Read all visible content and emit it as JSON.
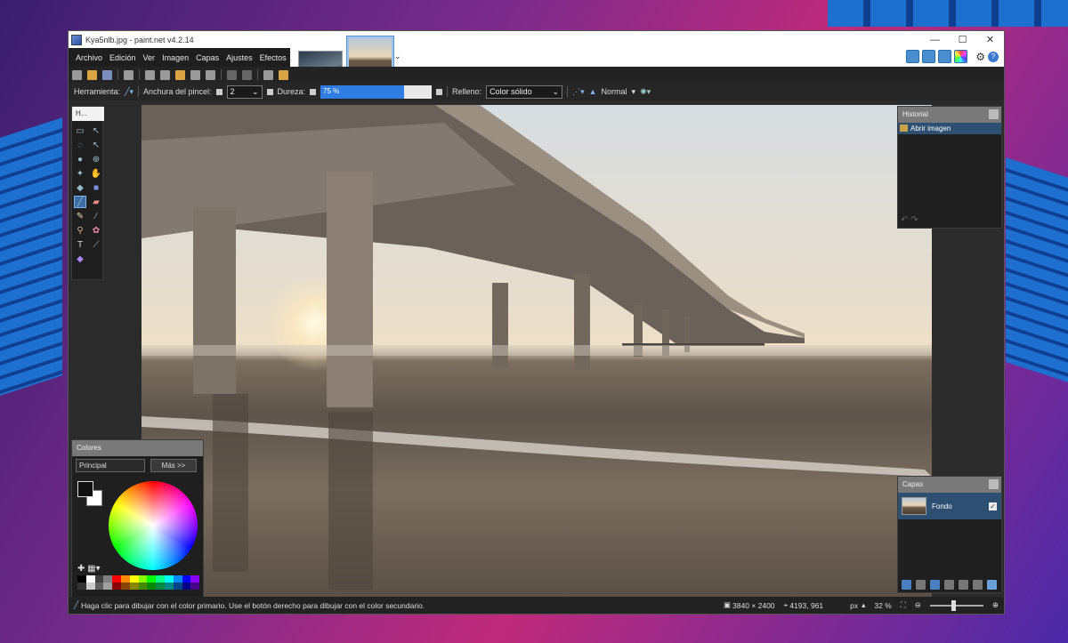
{
  "window": {
    "title": "Kya5nlb.jpg - paint.net v4.2.14"
  },
  "window_controls": {
    "minimize": "—",
    "maximize": "☐",
    "close": "✕"
  },
  "menu": {
    "items": [
      "Archivo",
      "Edición",
      "Ver",
      "Imagen",
      "Capas",
      "Ajustes",
      "Efectos"
    ]
  },
  "options": {
    "tool_label": "Herramienta:",
    "brush_width_label": "Anchura del pincel:",
    "brush_width_value": "2",
    "hardness_label": "Dureza:",
    "hardness_value": "75 %",
    "hardness_fraction": 0.75,
    "fill_label": "Relleno:",
    "fill_value": "Color sólido",
    "blend_mode": "Normal"
  },
  "tools_panel": {
    "title": "H..."
  },
  "history": {
    "title": "Historial",
    "items": [
      "Abrir imagen"
    ]
  },
  "layers": {
    "title": "Capas",
    "items": [
      {
        "name": "Fondo",
        "visible": true
      }
    ]
  },
  "colors": {
    "title": "Colores",
    "mode": "Principal",
    "more_button": "Más >>",
    "primary": "#111111",
    "secondary": "#ffffff"
  },
  "status": {
    "hint": "Haga clic para dibujar con el color primario. Use el botón derecho para dibujar con el color secundario.",
    "image_size": "3840 × 2400",
    "cursor_pos": "4193, 961",
    "unit": "px",
    "zoom": "32 %"
  },
  "accent": "#2f7de0"
}
